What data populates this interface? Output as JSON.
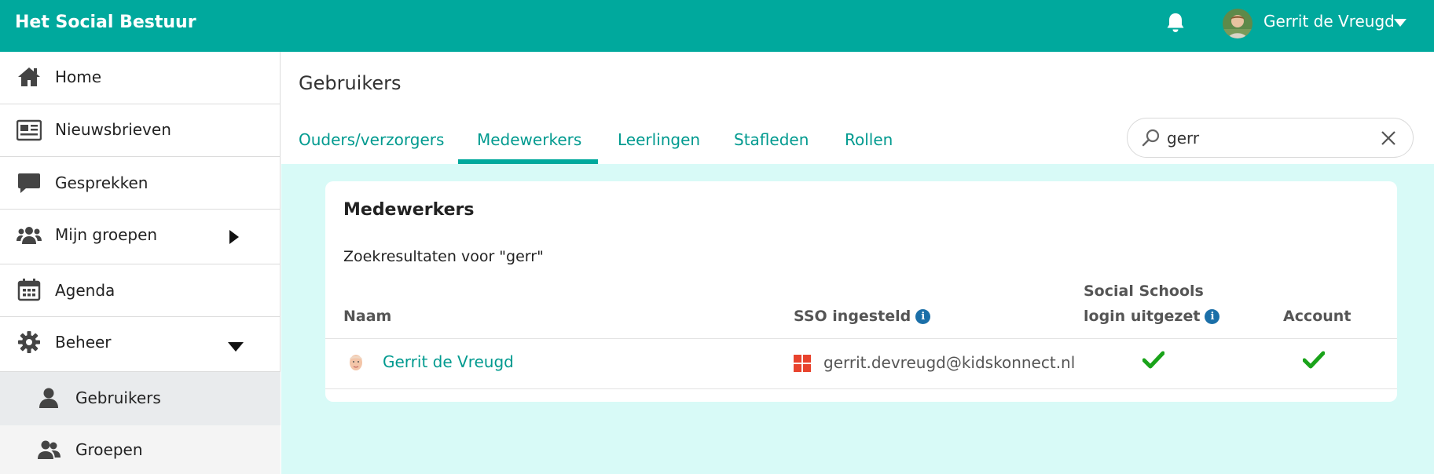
{
  "header": {
    "brand": "Het Social Bestuur",
    "user_name": "Gerrit de Vreugd",
    "icons": [
      "bell-icon",
      "avatar",
      "chevron-down-icon"
    ]
  },
  "sidebar": {
    "items": [
      {
        "label": "Home",
        "icon": "home-icon"
      },
      {
        "label": "Nieuwsbrieven",
        "icon": "newspaper-icon"
      },
      {
        "label": "Gesprekken",
        "icon": "chat-icon"
      },
      {
        "label": "Mijn groepen",
        "icon": "group-icon"
      },
      {
        "label": "Agenda",
        "icon": "calendar-icon"
      },
      {
        "label": "Beheer",
        "icon": "gear-icon"
      }
    ],
    "subitems": [
      {
        "label": "Gebruikers",
        "icon": "user-icon",
        "active": true
      },
      {
        "label": "Groepen",
        "icon": "users-icon",
        "active": false
      }
    ]
  },
  "main": {
    "title": "Gebruikers",
    "tabs": [
      {
        "label": "Ouders/verzorgers"
      },
      {
        "label": "Medewerkers",
        "active": true
      },
      {
        "label": "Leerlingen"
      },
      {
        "label": "Stafleden"
      },
      {
        "label": "Rollen"
      }
    ],
    "search": {
      "value": "gerr",
      "placeholder": ""
    }
  },
  "card": {
    "title": "Medewerkers",
    "results_label": "Zoekresultaten voor \"gerr\"",
    "columns": {
      "name": "Naam",
      "sso": "SSO ingesteld",
      "social_line1": "Social Schools",
      "social_line2": "login uitgezet",
      "account": "Account"
    },
    "rows": [
      {
        "name": "Gerrit de Vreugd",
        "email": "gerrit.devreugd@kidskonnect.nl",
        "social_login_disabled": true,
        "account": true
      }
    ]
  },
  "colors": {
    "brand": "#00a99d",
    "link": "#009a8f",
    "content_bg": "#d8faf7",
    "check": "#1aa31a",
    "info": "#1b6fa8",
    "microsoft": "#e8432d"
  }
}
